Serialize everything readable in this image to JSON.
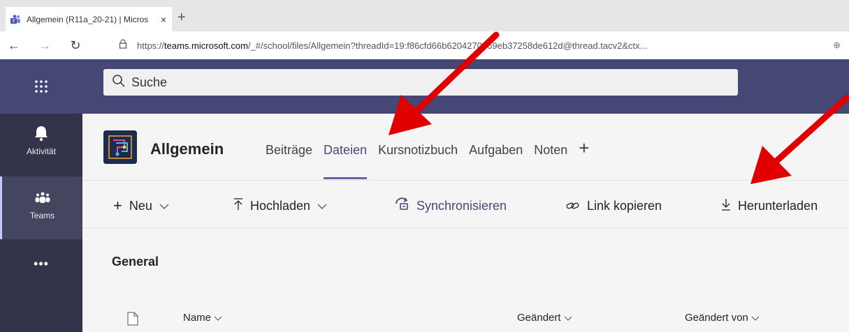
{
  "browser": {
    "tab_title": "Allgemein (R11a_20-21) | Micros",
    "tab_close": "×",
    "newtab": "+",
    "back": "←",
    "forward": "→",
    "reload": "↻",
    "url_prefix": "https://",
    "url_host": "teams.microsoft.com",
    "url_path": "/_#/school/files/Allgemein?threadId=19:f86cfd66b6204270969eb37258de612d@thread.tacv2&ctx...",
    "zoom": "⊕"
  },
  "header": {
    "search_placeholder": "Suche"
  },
  "rail": {
    "items": [
      {
        "label": "Aktivität"
      },
      {
        "label": "Teams"
      }
    ],
    "more": "•••"
  },
  "channel": {
    "name": "Allgemein",
    "tabs": [
      {
        "label": "Beiträge"
      },
      {
        "label": "Dateien"
      },
      {
        "label": "Kursnotizbuch"
      },
      {
        "label": "Aufgaben"
      },
      {
        "label": "Noten"
      }
    ],
    "add_tab": "+"
  },
  "toolbar": {
    "new_label": "Neu",
    "upload_label": "Hochladen",
    "sync_label": "Synchronisieren",
    "copy_link_label": "Link kopieren",
    "download_label": "Herunterladen"
  },
  "content": {
    "folder_title": "General",
    "columns": {
      "name": "Name",
      "modified": "Geändert",
      "modified_by": "Geändert von"
    }
  },
  "colors": {
    "teams_purple": "#464775",
    "rail_bg": "#33344a",
    "accent": "#6264a7",
    "arrow": "#e00000"
  }
}
